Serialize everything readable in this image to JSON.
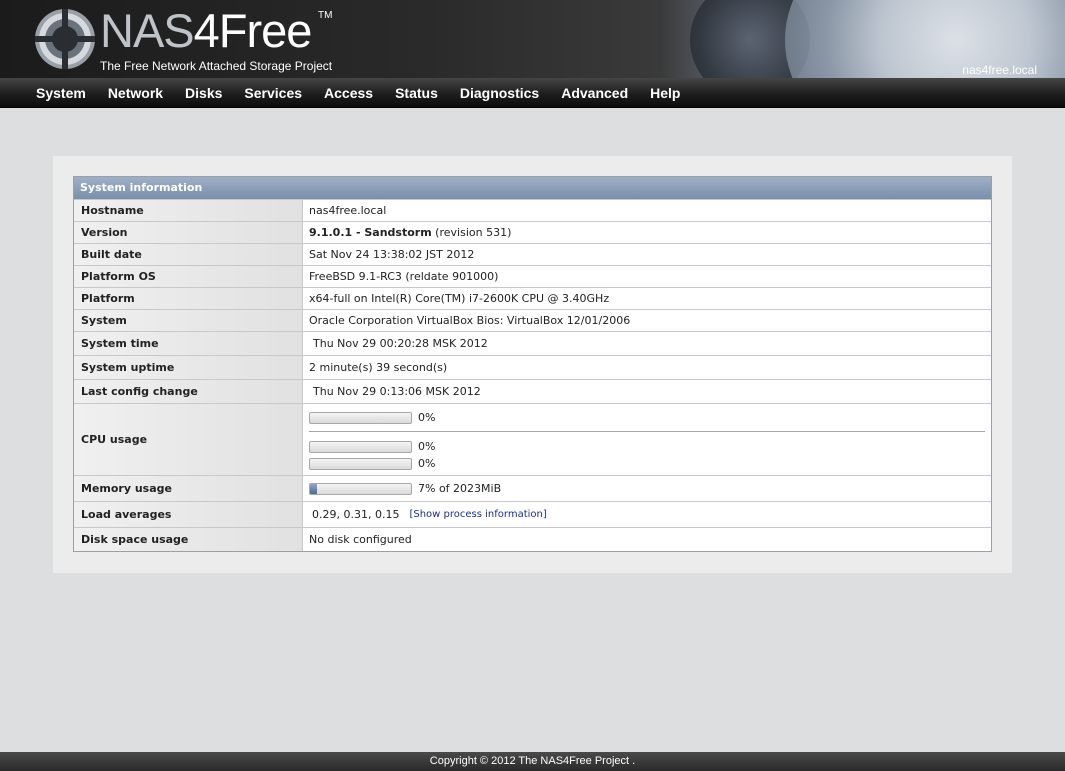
{
  "header": {
    "logo_prefix": "NAS",
    "logo_suffix": "4Free",
    "logo_tm": "TM",
    "tagline": "The Free Network Attached Storage Project",
    "hostname": "nas4free.local"
  },
  "nav": {
    "items": [
      "System",
      "Network",
      "Disks",
      "Services",
      "Access",
      "Status",
      "Diagnostics",
      "Advanced",
      "Help"
    ]
  },
  "sysinfo": {
    "title": "System information",
    "hostname_label": "Hostname",
    "hostname_value": "nas4free.local",
    "version_label": "Version",
    "version_bold": "9.1.0.1 - Sandstorm",
    "version_rest": " (revision 531)",
    "built_label": "Built date",
    "built_value": "Sat Nov 24 13:38:02 JST 2012",
    "platform_os_label": "Platform OS",
    "platform_os_value": "FreeBSD 9.1-RC3 (reldate 901000)",
    "platform_label": "Platform",
    "platform_value": "x64-full on Intel(R) Core(TM) i7-2600K CPU @ 3.40GHz",
    "system_label": "System",
    "system_value": "Oracle Corporation VirtualBox Bios: VirtualBox 12/01/2006",
    "time_label": "System time",
    "time_value": "Thu Nov 29 00:20:28 MSK 2012",
    "uptime_label": "System uptime",
    "uptime_value": "2 minute(s) 39 second(s)",
    "config_label": "Last config change",
    "config_value": "Thu Nov 29 0:13:06 MSK 2012",
    "cpu_label": "CPU usage",
    "cpu_total": 0,
    "cpu_total_text": "0%",
    "cpu_cores": [
      {
        "percent": 0,
        "text": "0%"
      },
      {
        "percent": 0,
        "text": "0%"
      }
    ],
    "memory_label": "Memory usage",
    "memory_percent": 7,
    "memory_text": "7% of 2023MiB",
    "load_label": "Load averages",
    "load_value": "0.29, 0.31, 0.15",
    "load_link": "[Show process information]",
    "disk_label": "Disk space usage",
    "disk_value": "No disk configured"
  },
  "footer": {
    "copyright": "Copyright © 2012 The NAS4Free Project ."
  },
  "colors": {
    "accent": "#7a8fab",
    "bar_fill": "#4a6a9c",
    "link": "#1a2f8a"
  }
}
